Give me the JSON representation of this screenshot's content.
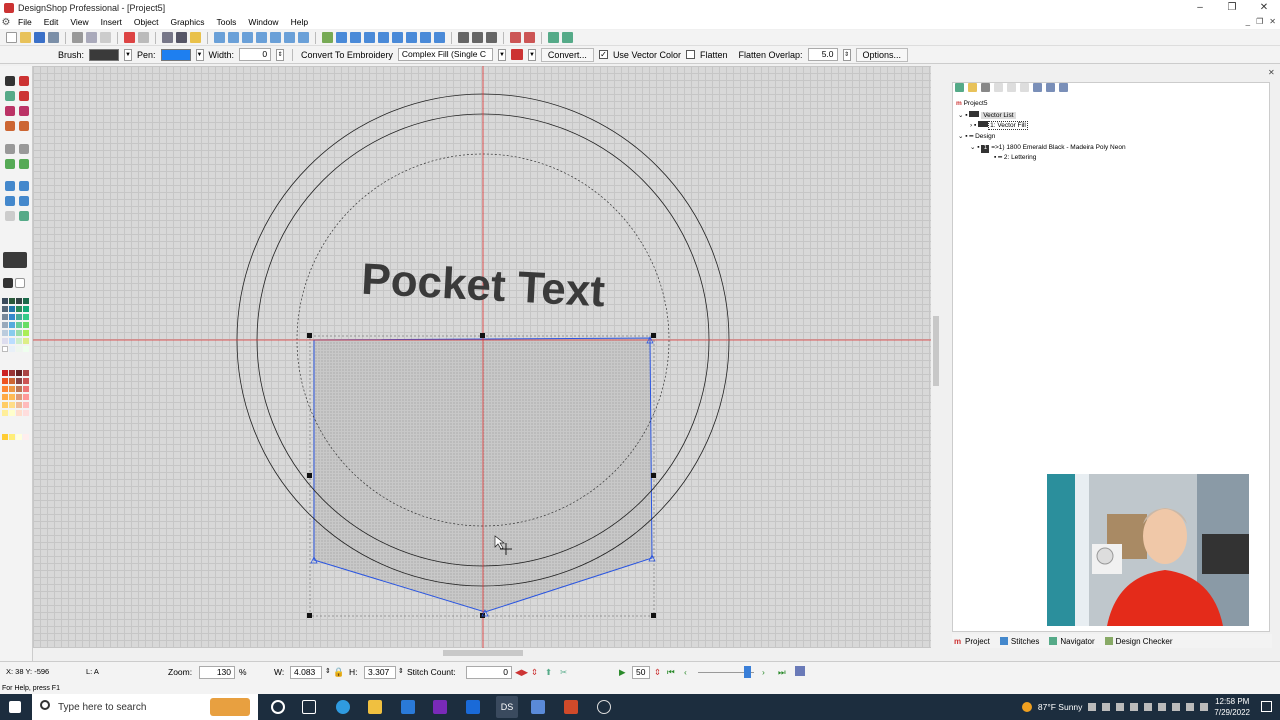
{
  "window": {
    "title": "DesignShop Professional - [Project5]",
    "controls": [
      "–",
      "❐",
      "✕"
    ]
  },
  "menu": [
    "File",
    "Edit",
    "View",
    "Insert",
    "Object",
    "Graphics",
    "Tools",
    "Window",
    "Help"
  ],
  "toolbar2": {
    "brush_label": "Brush:",
    "pen_label": "Pen:",
    "width_label": "Width:",
    "width_value": "0",
    "convert_label": "Convert To Embroidery",
    "fill_type": "Complex Fill (Single C",
    "convert_button": "Convert...",
    "use_vector_color": "Use Vector Color",
    "flatten": "Flatten",
    "flatten_overlap_label": "Flatten Overlap:",
    "flatten_overlap_value": "5.0",
    "options_button": "Options...",
    "brush_color": "#3a3a3a",
    "pen_color": "#1e7ff0"
  },
  "canvas": {
    "text": "Pocket Text"
  },
  "tree": {
    "project": "Project5",
    "vector_list": "Vector List",
    "vector_fill": "1: Vector Fill",
    "design": "Design",
    "thread": "=>1) 1800 Emerald Black - Madeira Poly Neon",
    "lettering": "2: Lettering"
  },
  "panel_tabs": [
    "Project",
    "Stitches",
    "Navigator",
    "Design Checker"
  ],
  "status": {
    "coords": "X: 38 Y: -596",
    "mode": "L: A",
    "zoom_label": "Zoom:",
    "zoom_value": "130",
    "zoom_unit": "%",
    "w_label": "W:",
    "w_value": "4.083",
    "h_label": "H:",
    "h_value": "3.307",
    "stitch_label": "Stitch Count:",
    "stitch_value": "0",
    "speed_value": "50"
  },
  "help_text": "For Help, press F1",
  "taskbar": {
    "search_placeholder": "Type here to search",
    "weather": "87°F  Sunny",
    "time": "12:58 PM",
    "date": "7/29/2022"
  },
  "colors": {
    "accent": "#1e7ff0",
    "guide": "#e03030",
    "taskbar": "#1c2d3e"
  }
}
